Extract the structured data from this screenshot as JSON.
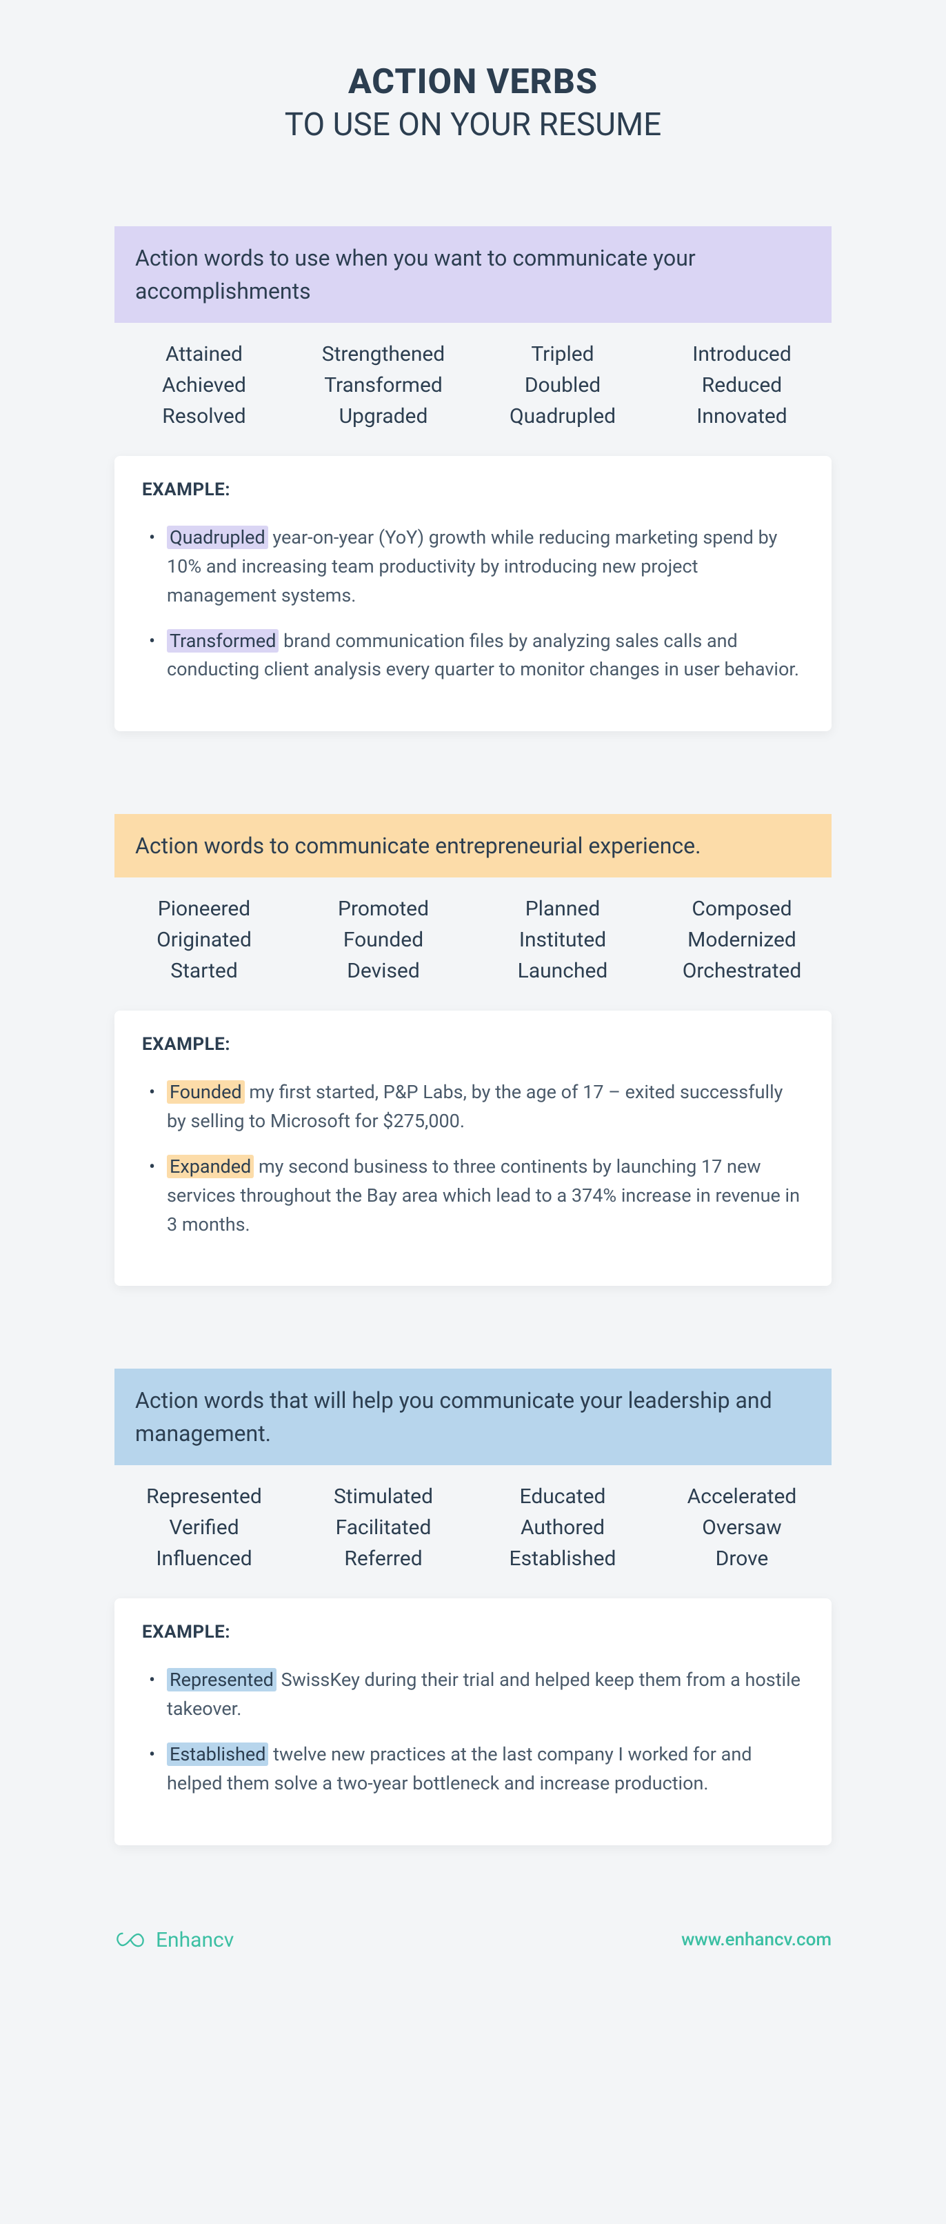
{
  "title": "ACTION VERBS",
  "subtitle": "TO USE ON YOUR RESUME",
  "exampleLabel": "EXAMPLE:",
  "sections": [
    {
      "heading": "Action words to use when you want to communicate your accomplishments",
      "headerClass": "header-purple",
      "hlClass": "hl-purple",
      "words": [
        "Attained",
        "Strengthened",
        "Tripled",
        "Introduced",
        "Achieved",
        "Transformed",
        "Doubled",
        "Reduced",
        "Resolved",
        "Upgraded",
        "Quadrupled",
        "Innovated"
      ],
      "examples": [
        {
          "hl": "Quadrupled",
          "rest": " year-on-year (YoY) growth while reducing marketing spend by 10% and increasing team productivity by introducing new project management systems."
        },
        {
          "hl": "Transformed",
          "rest": " brand communication files by analyzing sales calls and conducting client analysis every quarter to monitor changes in user behavior."
        }
      ]
    },
    {
      "heading": "Action words to communicate entrepreneurial experience.",
      "headerClass": "header-orange",
      "hlClass": "hl-orange",
      "words": [
        "Pioneered",
        "Promoted",
        "Planned",
        "Composed",
        "Originated",
        "Founded",
        "Instituted",
        "Modernized",
        "Started",
        "Devised",
        "Launched",
        "Orchestrated"
      ],
      "examples": [
        {
          "hl": "Founded",
          "rest": " my first started, P&P Labs, by the age of 17 – exited successfully by selling to Microsoft for $275,000."
        },
        {
          "hl": "Expanded",
          "rest": " my second business to three continents by launching 17 new services throughout the Bay area which lead to a 374% increase in revenue in 3 months."
        }
      ]
    },
    {
      "heading": "Action words that will help you communicate your leadership and management.",
      "headerClass": "header-blue",
      "hlClass": "hl-blue",
      "words": [
        "Represented",
        "Stimulated",
        "Educated",
        "Accelerated",
        "Verified",
        "Facilitated",
        "Authored",
        "Oversaw",
        "Influenced",
        "Referred",
        "Established",
        "Drove"
      ],
      "examples": [
        {
          "hl": "Represented",
          "rest": " SwissKey during their trial and helped keep them from a hostile takeover."
        },
        {
          "hl": "Established",
          "rest": " twelve new practices at the last company I worked for and helped them solve a two-year bottleneck and increase production."
        }
      ]
    }
  ],
  "footer": {
    "brand": "Enhancv",
    "url": "www.enhancv.com"
  }
}
